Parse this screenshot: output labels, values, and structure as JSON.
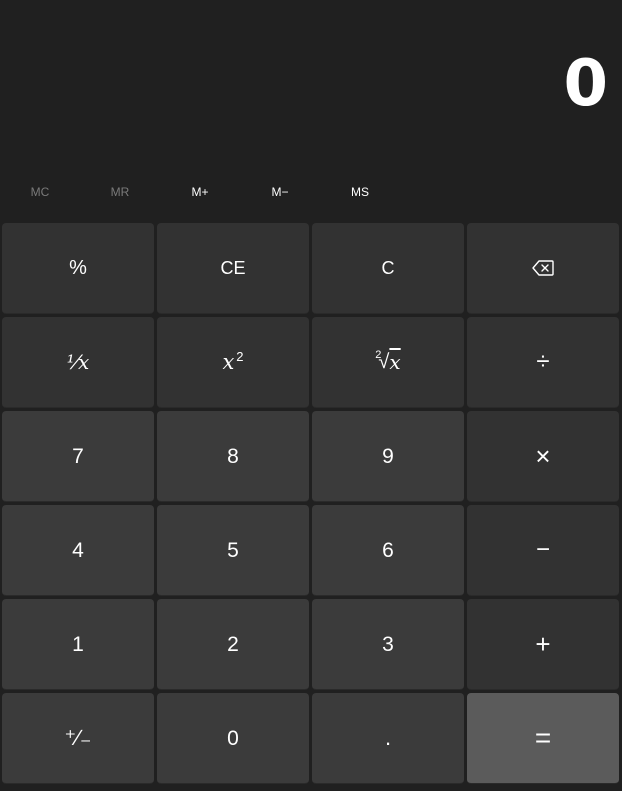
{
  "display": {
    "value": "0"
  },
  "memory": {
    "mc": "MC",
    "mr": "MR",
    "mplus": "M+",
    "mminus": "M−",
    "ms": "MS"
  },
  "keys": {
    "percent": "%",
    "ce": "CE",
    "c": "C",
    "backspace_icon": "backspace-icon",
    "reciprocal": "⅟x",
    "square_base": "x",
    "square_exp": "2",
    "sqrt_index": "2",
    "sqrt_radical": "√",
    "sqrt_x": "x",
    "divide": "÷",
    "seven": "7",
    "eight": "8",
    "nine": "9",
    "multiply": "×",
    "four": "4",
    "five": "5",
    "six": "6",
    "minus": "−",
    "one": "1",
    "two": "2",
    "three": "3",
    "plus": "+",
    "negate": "⁺∕₋",
    "zero": "0",
    "decimal": ".",
    "equals": "="
  },
  "colors": {
    "background": "#202020",
    "function_key": "#323232",
    "number_key": "#3b3b3b",
    "equals_key": "#5b5b5b",
    "disabled_text": "#7a7a7a"
  }
}
